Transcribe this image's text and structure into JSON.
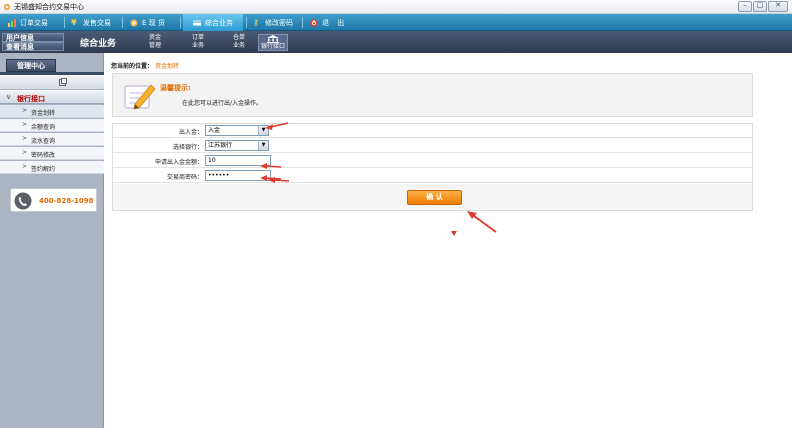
{
  "window": {
    "title": "无锡盛知合约交易中心",
    "controls": [
      "minimize",
      "maximize",
      "close"
    ]
  },
  "topnav": {
    "items": [
      {
        "label": "订单交易",
        "icon": "chart-icon"
      },
      {
        "label": "发售交易",
        "icon": "yen-icon"
      },
      {
        "label": "E 现 货",
        "icon": "globe-icon"
      },
      {
        "label": "综合业务",
        "icon": "card-icon",
        "active": true
      },
      {
        "label": "修改密码",
        "icon": "key-icon"
      },
      {
        "label": "退 出",
        "icon": "power-icon"
      }
    ]
  },
  "subbar": {
    "user_info": "用户信息",
    "view_msg": "查看消息",
    "section_title": "综合业务",
    "tabs": [
      {
        "line1": "资金",
        "line2": "管理"
      },
      {
        "line1": "订单",
        "line2": "业务"
      },
      {
        "line1": "仓单",
        "line2": "业务"
      },
      {
        "line1": "",
        "line2": "银行接口",
        "active": true
      }
    ]
  },
  "sidebar": {
    "header": "管理中心",
    "group": "银行接口",
    "items": [
      "资金划转",
      "余额查询",
      "流水查询",
      "密码修改",
      "签约解约"
    ],
    "selected": "资金划转",
    "phone": "400-828-1098"
  },
  "main": {
    "crumb_label": "您当前的位置：",
    "crumb_current": "资金划转",
    "tip_title": "温馨提示:",
    "tip_text": "在此您可以进行出/入金操作。",
    "form": {
      "direction_label": "出入金：",
      "direction_value": "入金",
      "bank_label": "选择银行：",
      "bank_value": "江苏银行",
      "amount_label": "申请出入金金额：",
      "amount_value": "10",
      "password_label": "交易商密码：",
      "password_value": "••••••",
      "confirm_label": "确 认"
    }
  },
  "colors": {
    "nav_blue": "#1f77a8",
    "accent_orange": "#f07d00",
    "annotation_red": "#e03b2e",
    "sidebar_gray": "#aab4c2"
  }
}
